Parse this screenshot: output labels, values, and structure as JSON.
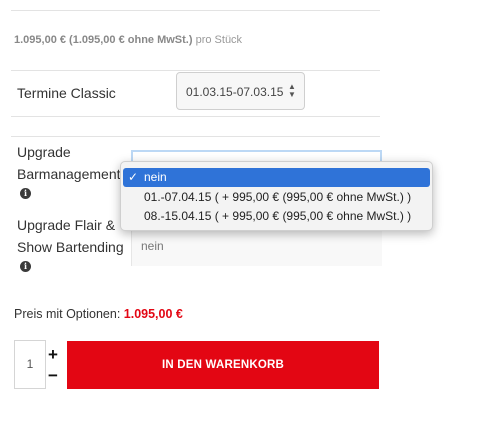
{
  "product": {
    "price_bold": "1.095,00 € (1.095,00 € ohne MwSt.)",
    "price_unit": "pro Stück"
  },
  "options": {
    "termine": {
      "label": "Termine Classic",
      "selected": "01.03.15-07.03.15"
    },
    "barmanagement": {
      "label_line1": "Upgrade",
      "label_line2": "Barmanagement",
      "info_glyph": "i",
      "dropdown": [
        {
          "label": "nein",
          "checked": "✓",
          "selected": true
        },
        {
          "label": "01.-07.04.15 ( + 995,00 € (995,00 € ohne MwSt.) )",
          "checked": "",
          "selected": false
        },
        {
          "label": "08.-15.04.15 ( + 995,00 € (995,00 € ohne MwSt.) )",
          "checked": "",
          "selected": false
        }
      ]
    },
    "flair": {
      "label_line1": "Upgrade Flair &",
      "label_line2": "Show Bartending",
      "info_glyph": "i",
      "value": "nein"
    }
  },
  "summary": {
    "label": "Preis mit Optionen:",
    "amount": "1.095,00 €"
  },
  "cart": {
    "quantity": "1",
    "plus": "+",
    "minus": "−",
    "button_label": "IN DEN WARENKORB"
  },
  "colors": {
    "accent_red": "#e30613",
    "selection_blue": "#2f73d8"
  },
  "icons": {
    "info": "info-icon",
    "select_arrows": "up-down-arrows-icon",
    "checkmark": "checkmark-icon"
  }
}
